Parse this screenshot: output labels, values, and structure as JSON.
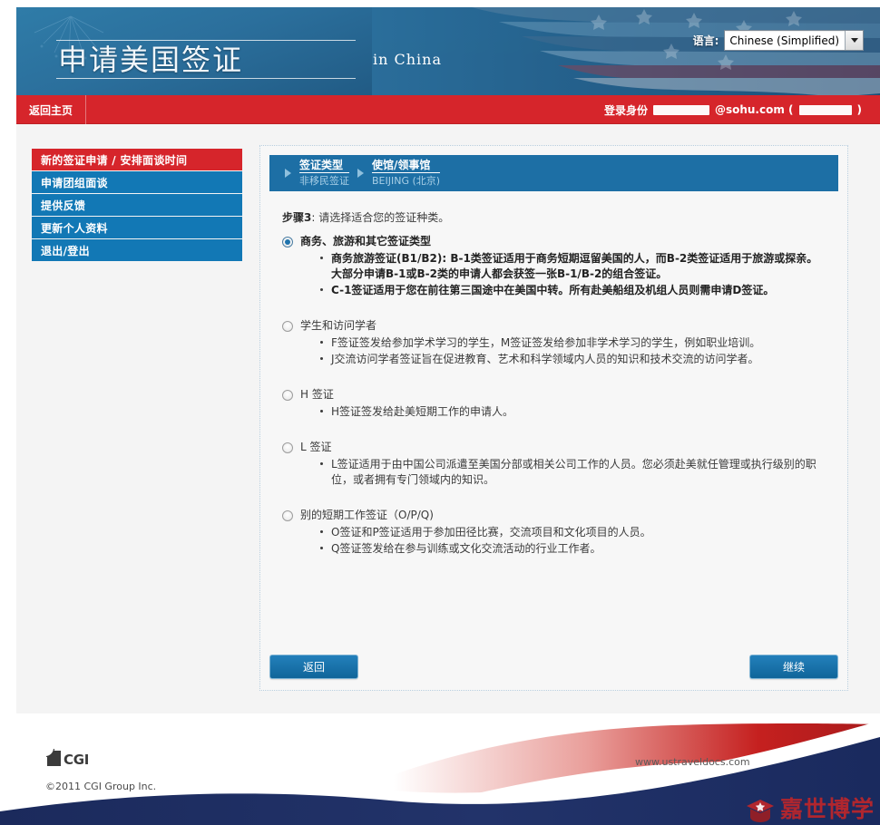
{
  "header": {
    "title": "申请美国签证",
    "subtitle": "in China",
    "language_label": "语言:",
    "language_value": "Chinese (Simplified)",
    "dropdown_icon": "chevron-down-icon"
  },
  "login_bar": {
    "home_label": "返回主页",
    "login_prefix": "登录身份",
    "email_suffix": "@sohu.com (",
    "email_close": ")"
  },
  "sidebar": {
    "items": [
      {
        "label": "新的签证申请 / 安排面谈时间",
        "active": true
      },
      {
        "label": "申请团组面谈",
        "active": false
      },
      {
        "label": "提供反馈",
        "active": false
      },
      {
        "label": "更新个人资料",
        "active": false
      },
      {
        "label": "退出/登出",
        "active": false
      }
    ]
  },
  "breadcrumb": [
    {
      "title": "签证类型",
      "sub": "非移民签证"
    },
    {
      "title": "使馆/领事馆",
      "sub": "BEIJING (北京)"
    }
  ],
  "main": {
    "step_label": "步骤3",
    "step_text": ": 请选择适合您的签证种类。",
    "options": [
      {
        "label": "商务、旅游和其它签证类型",
        "selected": true,
        "bullets": [
          "商务旅游签证(B1/B2): B-1类签证适用于商务短期逗留美国的人，而B-2类签证适用于旅游或探亲。大部分申请B-1或B-2类的申请人都会获签一张B-1/B-2的组合签证。",
          "C-1签证适用于您在前往第三国途中在美国中转。所有赴美船组及机组人员则需申请D签证。"
        ]
      },
      {
        "label": "学生和访问学者",
        "selected": false,
        "bullets": [
          "F签证签发给参加学术学习的学生，M签证签发给参加非学术学习的学生，例如职业培训。",
          "J交流访问学者签证旨在促进教育、艺术和科学领域内人员的知识和技术交流的访问学者。"
        ]
      },
      {
        "label": "H 签证",
        "selected": false,
        "bullets": [
          "H签证签发给赴美短期工作的申请人。"
        ]
      },
      {
        "label": "L 签证",
        "selected": false,
        "bullets": [
          "L签证适用于由中国公司派遣至美国分部或相关公司工作的人员。您必须赴美就任管理或执行级别的职位，或者拥有专门领域内的知识。"
        ]
      },
      {
        "label": "别的短期工作签证（O/P/Q)",
        "selected": false,
        "bullets": [
          "O签证和P签证适用于参加田径比赛，交流项目和文化项目的人员。",
          "Q签证签发给在参与训练或文化交流活动的行业工作者。"
        ]
      }
    ],
    "back_button": "返回",
    "next_button": "继续"
  },
  "footer": {
    "logo_text": "CGI",
    "copyright": "©2011 CGI Group Inc.",
    "site_url": "www.ustraveldocs.com",
    "watermark_text": "嘉世博学",
    "watermark_icon": "graduation-cap-icon"
  },
  "colors": {
    "brand_red": "#d6252b",
    "brand_blue": "#1278b5",
    "panel_header_blue": "#1d6fa5",
    "footer_navy": "#1f2f62",
    "footer_red": "#c0201f",
    "watermark_red": "#b0262e"
  }
}
